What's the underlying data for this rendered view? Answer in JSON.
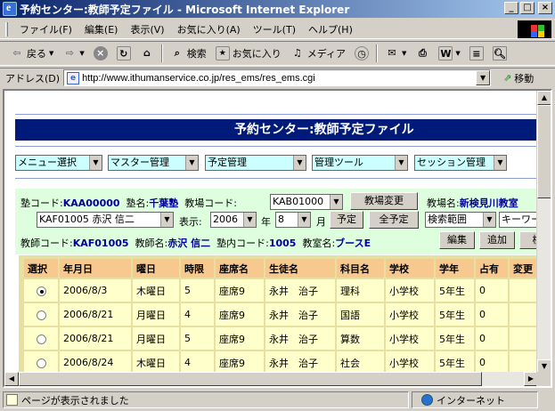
{
  "window": {
    "title": "予約センター:教師予定ファイル - Microsoft Internet Explorer",
    "min": "_",
    "max": "□",
    "close": "×"
  },
  "menu": [
    "ファイル(F)",
    "編集(E)",
    "表示(V)",
    "お気に入り(A)",
    "ツール(T)",
    "ヘルプ(H)"
  ],
  "toolbar": {
    "back": "戻る",
    "search": "検索",
    "favorites": "お気に入り",
    "media": "メディア"
  },
  "address": {
    "label": "アドレス(D)",
    "url": "http://www.ithumanservice.co.jp/res_ems/res_ems.cgi",
    "go": "移動"
  },
  "page": {
    "banner": "予約センター:教師予定ファイル",
    "nav_selects": [
      "メニュー選択",
      "マスター管理",
      "予定管理",
      "管理ツール",
      "セッション管理"
    ],
    "form": {
      "school_code_label": "塾コード:",
      "school_code": "KAA00000",
      "school_name_label": "塾名:",
      "school_name": "千葉塾",
      "campus_code_label": "教場コード:",
      "campus_code": "KAB01000",
      "campus_change": "教場変更",
      "campus_name_label": "教場名:",
      "campus_name": "新検見川教室",
      "teacher_select": "KAF01005 赤沢 信二",
      "display_label": "表示:",
      "year": "2006",
      "year_unit": "年",
      "month": "8",
      "month_unit": "月",
      "plan_button": "予定",
      "all_plan_button": "全予定",
      "search_range": "検索範囲",
      "keyword": "キーワー",
      "teacher_code_label": "教師コード:",
      "teacher_code": "KAF01005",
      "teacher_name_label": "教師名:",
      "teacher_name": "赤沢 信二",
      "inner_code_label": "塾内コード:",
      "inner_code": "1005",
      "room_label": "教室名:",
      "room_name": "ブースE",
      "edit_button": "編集",
      "add_button": "追加",
      "extra_button": "検"
    },
    "table": {
      "headers": [
        "選択",
        "年月日",
        "曜日",
        "時限",
        "座席名",
        "生徒名",
        "科目名",
        "学校",
        "学年",
        "占有",
        "変更"
      ],
      "rows": [
        {
          "selected": true,
          "cells": [
            "2006/8/3",
            "木曜日",
            "5",
            "座席9",
            "永井　治子",
            "理科",
            "小学校",
            "5年生",
            "0",
            ""
          ]
        },
        {
          "selected": false,
          "cells": [
            "2006/8/21",
            "月曜日",
            "4",
            "座席9",
            "永井　治子",
            "国語",
            "小学校",
            "5年生",
            "0",
            ""
          ]
        },
        {
          "selected": false,
          "cells": [
            "2006/8/21",
            "月曜日",
            "5",
            "座席9",
            "永井　治子",
            "算数",
            "小学校",
            "5年生",
            "0",
            ""
          ]
        },
        {
          "selected": false,
          "cells": [
            "2006/8/24",
            "木曜日",
            "4",
            "座席9",
            "永井　治子",
            "社会",
            "小学校",
            "5年生",
            "0",
            ""
          ]
        }
      ]
    }
  },
  "status": {
    "left": "ページが表示されました",
    "right": "インターネット"
  }
}
